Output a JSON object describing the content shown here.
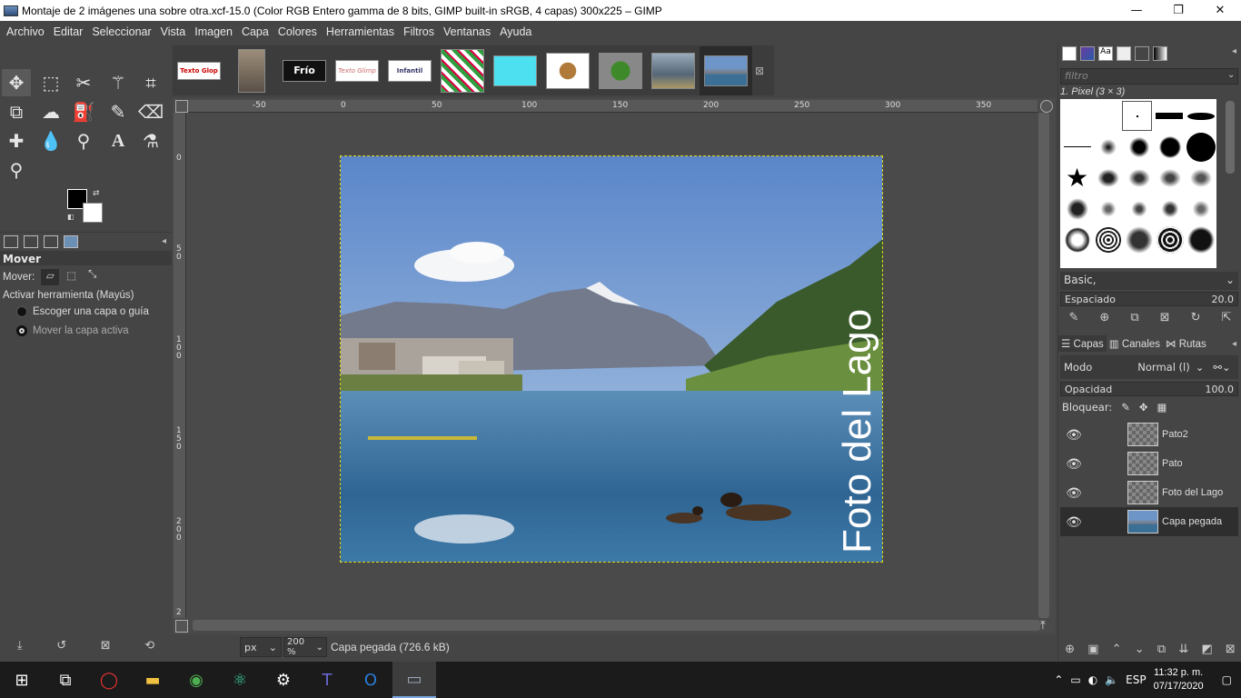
{
  "window": {
    "title": "Montaje de 2 imágenes una sobre otra.xcf-15.0 (Color RGB Entero gamma de 8 bits, GIMP built-in sRGB, 4 capas) 300x225 – GIMP",
    "minimize": "—",
    "maximize": "❐",
    "close": "✕"
  },
  "menu": [
    "Archivo",
    "Editar",
    "Seleccionar",
    "Vista",
    "Imagen",
    "Capa",
    "Colores",
    "Herramientas",
    "Filtros",
    "Ventanas",
    "Ayuda"
  ],
  "image_tabs": [
    {
      "label": "Texto Glop"
    },
    {
      "label": ""
    },
    {
      "label": "Frío"
    },
    {
      "label": "Texto Glimp"
    },
    {
      "label": "Infantil"
    },
    {
      "label": ""
    },
    {
      "label": ""
    },
    {
      "label": ""
    },
    {
      "label": ""
    },
    {
      "label": ""
    },
    {
      "label": ""
    }
  ],
  "tool_options": {
    "title": "Mover",
    "mover_label": "Mover:",
    "toggle_label": "Activar herramienta  (Mayús)",
    "option1": "Escoger una capa o guía",
    "option2": "Mover la capa activa"
  },
  "rulers": {
    "h": [
      "-50",
      "0",
      "50",
      "100",
      "150",
      "200",
      "250",
      "300",
      "350"
    ],
    "v": [
      "0",
      "5 0",
      "1 0 0",
      "1 5 0",
      "2 0 0",
      "2"
    ]
  },
  "canvas": {
    "overlay_text": "Foto del Lago"
  },
  "status": {
    "unit": "px",
    "zoom": "200 %",
    "text": "Capa pegada (726.6 kB)"
  },
  "brushes": {
    "filter_placeholder": "filtro",
    "selected": "1. Pixel (3 × 3)",
    "preset": "Basic,",
    "spacing_label": "Espaciado",
    "spacing_value": "20.0"
  },
  "layers": {
    "tabs": [
      "Capas",
      "Canales",
      "Rutas"
    ],
    "mode_label": "Modo",
    "mode_value": "Normal (l)",
    "opacity_label": "Opacidad",
    "opacity_value": "100.0",
    "lock_label": "Bloquear:",
    "items": [
      {
        "name": "Pato2"
      },
      {
        "name": "Pato"
      },
      {
        "name": "Foto del Lago"
      },
      {
        "name": "Capa pegada"
      }
    ]
  },
  "taskbar": {
    "lang": "ESP",
    "time": "11:32 p. m.",
    "date": "07/17/2020"
  }
}
